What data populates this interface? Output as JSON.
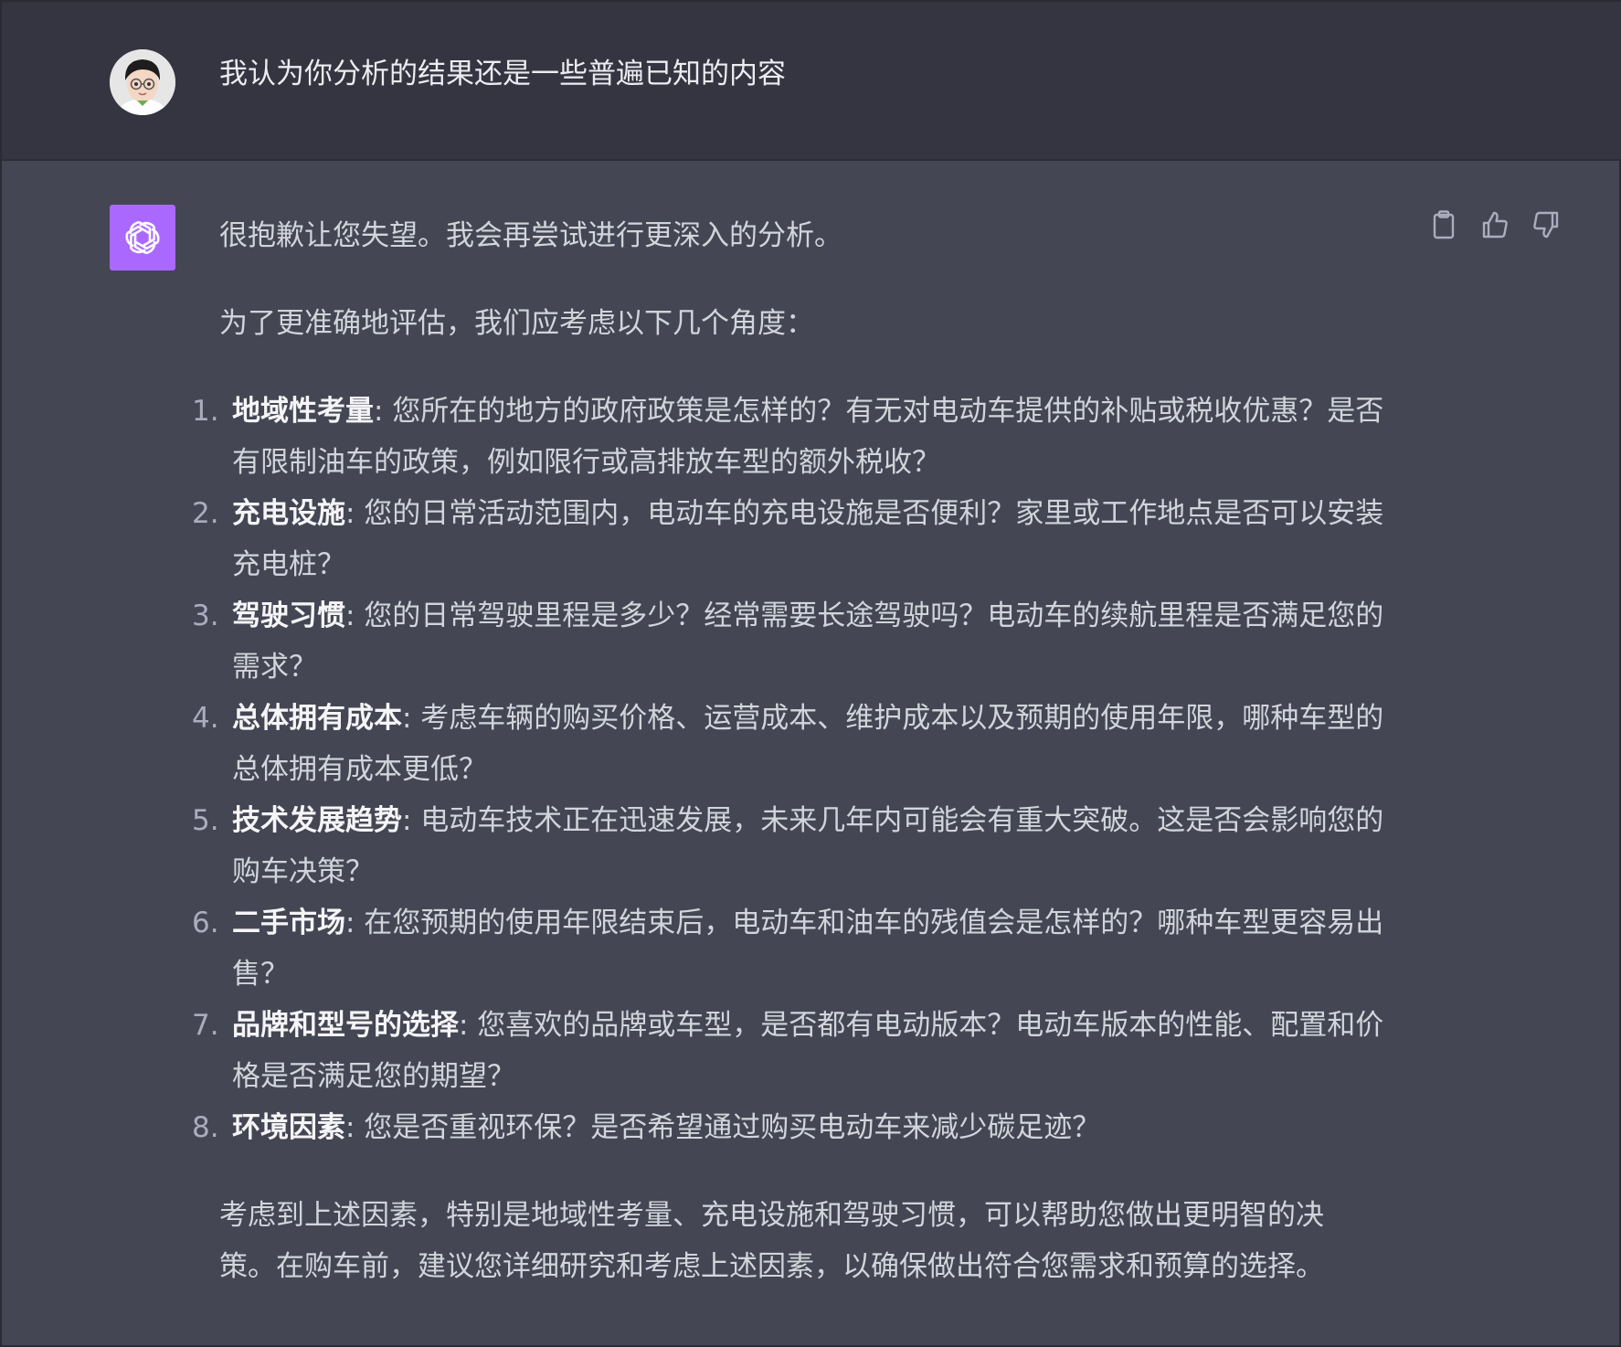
{
  "user_message": {
    "text": "我认为你分析的结果还是一些普遍已知的内容"
  },
  "assistant_message": {
    "intro": "很抱歉让您失望。我会再尝试进行更深入的分析。",
    "lead": "为了更准确地评估，我们应考虑以下几个角度：",
    "items": [
      {
        "num": "1.",
        "term": "地域性考量",
        "text": ": 您所在的地方的政府政策是怎样的？有无对电动车提供的补贴或税收优惠？是否有限制油车的政策，例如限行或高排放车型的额外税收？"
      },
      {
        "num": "2.",
        "term": "充电设施",
        "text": ": 您的日常活动范围内，电动车的充电设施是否便利？家里或工作地点是否可以安装充电桩？"
      },
      {
        "num": "3.",
        "term": "驾驶习惯",
        "text": ": 您的日常驾驶里程是多少？经常需要长途驾驶吗？电动车的续航里程是否满足您的需求？"
      },
      {
        "num": "4.",
        "term": "总体拥有成本",
        "text": ": 考虑车辆的购买价格、运营成本、维护成本以及预期的使用年限，哪种车型的总体拥有成本更低？"
      },
      {
        "num": "5.",
        "term": "技术发展趋势",
        "text": ": 电动车技术正在迅速发展，未来几年内可能会有重大突破。这是否会影响您的购车决策？"
      },
      {
        "num": "6.",
        "term": "二手市场",
        "text": ": 在您预期的使用年限结束后，电动车和油车的残值会是怎样的？哪种车型更容易出售？"
      },
      {
        "num": "7.",
        "term": "品牌和型号的选择",
        "text": ": 您喜欢的品牌或车型，是否都有电动版本？电动车版本的性能、配置和价格是否满足您的期望？"
      },
      {
        "num": "8.",
        "term": "环境因素",
        "text": ": 您是否重视环保？是否希望通过购买电动车来减少碳足迹？"
      }
    ],
    "closing": "考虑到上述因素，特别是地域性考量、充电设施和驾驶习惯，可以帮助您做出更明智的决策。在购车前，建议您详细研究和考虑上述因素，以确保做出符合您需求和预算的选择。"
  },
  "icons": {
    "copy": "clipboard-icon",
    "like": "thumbs-up-icon",
    "dislike": "thumbs-down-icon",
    "bot": "openai-logo-icon"
  },
  "colors": {
    "user_bg": "#343541",
    "assistant_bg": "#444654",
    "bot_avatar": "#ab68ff",
    "text": "#d1d5db"
  }
}
